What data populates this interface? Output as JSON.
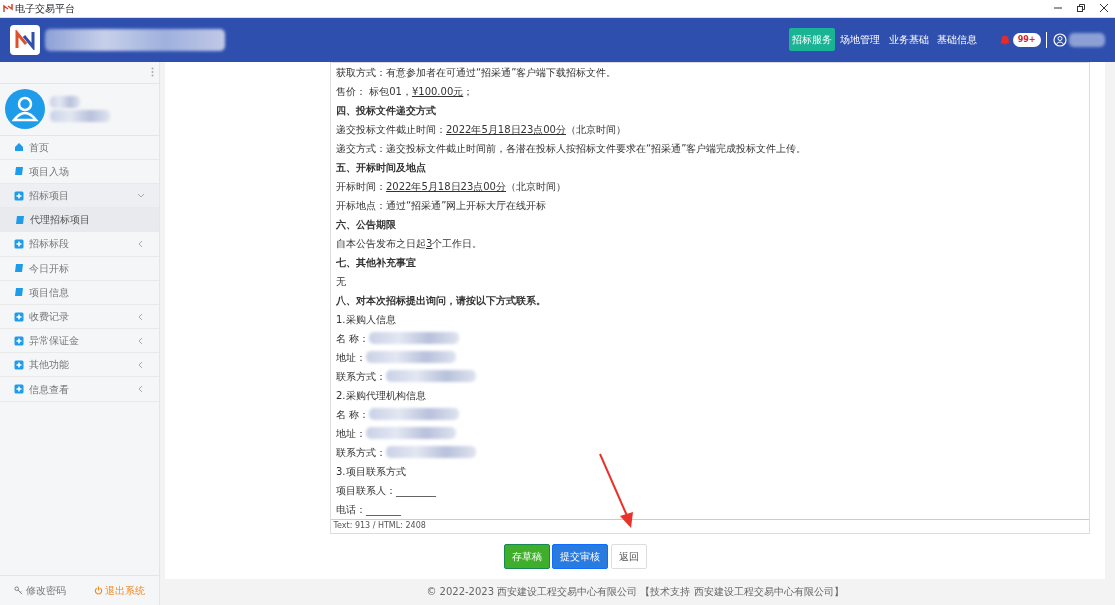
{
  "window": {
    "title": "电子交易平台"
  },
  "header": {
    "nav": [
      {
        "label": "招标服务",
        "selected": true
      },
      {
        "label": "场地管理",
        "selected": false
      },
      {
        "label": "业务基础",
        "selected": false
      },
      {
        "label": "基础信息",
        "selected": false
      }
    ],
    "notification_badge": "99+"
  },
  "sidebar": {
    "items": [
      {
        "label": "首页",
        "kind": "home",
        "selected": false
      },
      {
        "label": "项目入场",
        "kind": "page",
        "selected": false
      },
      {
        "label": "招标项目",
        "kind": "group",
        "expanded": true,
        "selected": false,
        "children": [
          {
            "label": "代理招标项目",
            "kind": "page",
            "selected": true
          }
        ]
      },
      {
        "label": "招标标段",
        "kind": "group",
        "expanded": false,
        "selected": false
      },
      {
        "label": "今日开标",
        "kind": "page",
        "selected": false
      },
      {
        "label": "项目信息",
        "kind": "page",
        "selected": false
      },
      {
        "label": "收费记录",
        "kind": "group",
        "expanded": false,
        "selected": false
      },
      {
        "label": "异常保证金",
        "kind": "group",
        "expanded": false,
        "selected": false
      },
      {
        "label": "其他功能",
        "kind": "group",
        "expanded": false,
        "selected": false
      },
      {
        "label": "信息查看",
        "kind": "group",
        "expanded": false,
        "selected": false
      }
    ],
    "footer_links": [
      {
        "label": "修改密码",
        "kind": "key"
      },
      {
        "label": "退出系统",
        "kind": "power"
      }
    ]
  },
  "editor": {
    "lines": [
      {
        "kind": "text",
        "parts": [
          {
            "text": "获取方式：有意参加者在可通过“招采通”客户端下载招标文件。"
          }
        ]
      },
      {
        "kind": "text",
        "parts": [
          {
            "text": "售价： 标包01，"
          },
          {
            "text": "¥100.00元",
            "underline": true
          },
          {
            "text": "；"
          }
        ]
      },
      {
        "kind": "heading",
        "parts": [
          {
            "text": "四、投标文件递交方式"
          }
        ]
      },
      {
        "kind": "text",
        "parts": [
          {
            "text": "递交投标文件截止时间："
          },
          {
            "text": "2022年5月18日23点00分",
            "underline": true
          },
          {
            "text": "（北京时间）"
          }
        ]
      },
      {
        "kind": "text",
        "parts": [
          {
            "text": "递交方式：递交投标文件截止时间前，各潜在投标人按招标文件要求在“招采通”客户端完成投标文件上传。"
          }
        ]
      },
      {
        "kind": "heading",
        "parts": [
          {
            "text": "五、开标时间及地点"
          }
        ]
      },
      {
        "kind": "text",
        "parts": [
          {
            "text": "开标时间："
          },
          {
            "text": "2022年5月18日23点00分",
            "underline": true
          },
          {
            "text": "（北京时间）"
          }
        ]
      },
      {
        "kind": "text",
        "parts": [
          {
            "text": "开标地点：通过“招采通”网上开标大厅在线开标"
          }
        ]
      },
      {
        "kind": "heading",
        "parts": [
          {
            "text": "六、公告期限"
          }
        ]
      },
      {
        "kind": "text",
        "parts": [
          {
            "text": "自本公告发布之日起"
          },
          {
            "text": "3",
            "underline": true
          },
          {
            "text": "个工作日。"
          }
        ]
      },
      {
        "kind": "heading",
        "parts": [
          {
            "text": "七、其他补充事宜"
          }
        ]
      },
      {
        "kind": "text",
        "parts": [
          {
            "text": "无"
          }
        ]
      },
      {
        "kind": "heading",
        "parts": [
          {
            "text": "八、对本次招标提出询问，请按以下方式联系。"
          }
        ]
      },
      {
        "kind": "text",
        "parts": [
          {
            "text": "1.采购人信息"
          }
        ]
      },
      {
        "kind": "text",
        "parts": [
          {
            "text": "名 称："
          },
          {
            "redacted": true
          }
        ]
      },
      {
        "kind": "text",
        "parts": [
          {
            "text": "地址："
          },
          {
            "redacted": true
          }
        ]
      },
      {
        "kind": "text",
        "parts": [
          {
            "text": "联系方式："
          },
          {
            "redacted": true
          }
        ]
      },
      {
        "kind": "text",
        "parts": [
          {
            "text": "2.采购代理机构信息"
          }
        ]
      },
      {
        "kind": "text",
        "parts": [
          {
            "text": "名 称："
          },
          {
            "redacted": true
          }
        ]
      },
      {
        "kind": "text",
        "parts": [
          {
            "text": "地址："
          },
          {
            "redacted": true
          }
        ]
      },
      {
        "kind": "text",
        "parts": [
          {
            "text": "联系方式："
          },
          {
            "redacted": true
          }
        ]
      },
      {
        "kind": "text",
        "parts": [
          {
            "text": "3.项目联系方式"
          }
        ]
      },
      {
        "kind": "text",
        "parts": [
          {
            "text": "项目联系人："
          },
          {
            "text": "________"
          }
        ]
      },
      {
        "kind": "text",
        "parts": [
          {
            "text": "电话："
          },
          {
            "text": "_______"
          }
        ]
      }
    ],
    "status": "Text: 913 / HTML: 2408"
  },
  "buttons": [
    {
      "label": "存草稿",
      "kind": "success"
    },
    {
      "label": "提交审核",
      "kind": "primary"
    },
    {
      "label": "返回",
      "kind": "plain"
    }
  ],
  "footer": "© 2022-2023 西安建设工程交易中心有限公司 【技术支持 西安建设工程交易中心有限公司】"
}
